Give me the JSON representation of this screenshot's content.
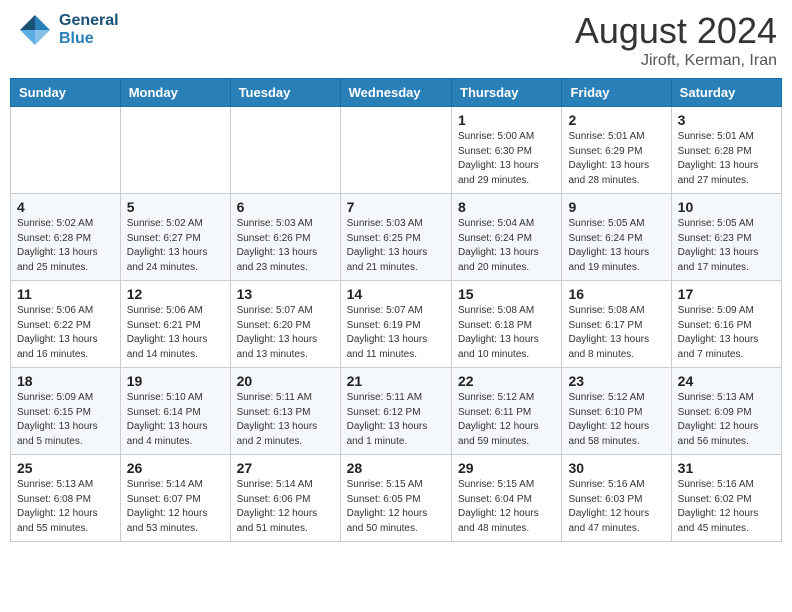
{
  "header": {
    "logo_general": "General",
    "logo_blue": "Blue",
    "title": "August 2024",
    "location": "Jiroft, Kerman, Iran"
  },
  "weekdays": [
    "Sunday",
    "Monday",
    "Tuesday",
    "Wednesday",
    "Thursday",
    "Friday",
    "Saturday"
  ],
  "weeks": [
    [
      {
        "date": "",
        "info": ""
      },
      {
        "date": "",
        "info": ""
      },
      {
        "date": "",
        "info": ""
      },
      {
        "date": "",
        "info": ""
      },
      {
        "date": "1",
        "info": "Sunrise: 5:00 AM\nSunset: 6:30 PM\nDaylight: 13 hours\nand 29 minutes."
      },
      {
        "date": "2",
        "info": "Sunrise: 5:01 AM\nSunset: 6:29 PM\nDaylight: 13 hours\nand 28 minutes."
      },
      {
        "date": "3",
        "info": "Sunrise: 5:01 AM\nSunset: 6:28 PM\nDaylight: 13 hours\nand 27 minutes."
      }
    ],
    [
      {
        "date": "4",
        "info": "Sunrise: 5:02 AM\nSunset: 6:28 PM\nDaylight: 13 hours\nand 25 minutes."
      },
      {
        "date": "5",
        "info": "Sunrise: 5:02 AM\nSunset: 6:27 PM\nDaylight: 13 hours\nand 24 minutes."
      },
      {
        "date": "6",
        "info": "Sunrise: 5:03 AM\nSunset: 6:26 PM\nDaylight: 13 hours\nand 23 minutes."
      },
      {
        "date": "7",
        "info": "Sunrise: 5:03 AM\nSunset: 6:25 PM\nDaylight: 13 hours\nand 21 minutes."
      },
      {
        "date": "8",
        "info": "Sunrise: 5:04 AM\nSunset: 6:24 PM\nDaylight: 13 hours\nand 20 minutes."
      },
      {
        "date": "9",
        "info": "Sunrise: 5:05 AM\nSunset: 6:24 PM\nDaylight: 13 hours\nand 19 minutes."
      },
      {
        "date": "10",
        "info": "Sunrise: 5:05 AM\nSunset: 6:23 PM\nDaylight: 13 hours\nand 17 minutes."
      }
    ],
    [
      {
        "date": "11",
        "info": "Sunrise: 5:06 AM\nSunset: 6:22 PM\nDaylight: 13 hours\nand 16 minutes."
      },
      {
        "date": "12",
        "info": "Sunrise: 5:06 AM\nSunset: 6:21 PM\nDaylight: 13 hours\nand 14 minutes."
      },
      {
        "date": "13",
        "info": "Sunrise: 5:07 AM\nSunset: 6:20 PM\nDaylight: 13 hours\nand 13 minutes."
      },
      {
        "date": "14",
        "info": "Sunrise: 5:07 AM\nSunset: 6:19 PM\nDaylight: 13 hours\nand 11 minutes."
      },
      {
        "date": "15",
        "info": "Sunrise: 5:08 AM\nSunset: 6:18 PM\nDaylight: 13 hours\nand 10 minutes."
      },
      {
        "date": "16",
        "info": "Sunrise: 5:08 AM\nSunset: 6:17 PM\nDaylight: 13 hours\nand 8 minutes."
      },
      {
        "date": "17",
        "info": "Sunrise: 5:09 AM\nSunset: 6:16 PM\nDaylight: 13 hours\nand 7 minutes."
      }
    ],
    [
      {
        "date": "18",
        "info": "Sunrise: 5:09 AM\nSunset: 6:15 PM\nDaylight: 13 hours\nand 5 minutes."
      },
      {
        "date": "19",
        "info": "Sunrise: 5:10 AM\nSunset: 6:14 PM\nDaylight: 13 hours\nand 4 minutes."
      },
      {
        "date": "20",
        "info": "Sunrise: 5:11 AM\nSunset: 6:13 PM\nDaylight: 13 hours\nand 2 minutes."
      },
      {
        "date": "21",
        "info": "Sunrise: 5:11 AM\nSunset: 6:12 PM\nDaylight: 13 hours\nand 1 minute."
      },
      {
        "date": "22",
        "info": "Sunrise: 5:12 AM\nSunset: 6:11 PM\nDaylight: 12 hours\nand 59 minutes."
      },
      {
        "date": "23",
        "info": "Sunrise: 5:12 AM\nSunset: 6:10 PM\nDaylight: 12 hours\nand 58 minutes."
      },
      {
        "date": "24",
        "info": "Sunrise: 5:13 AM\nSunset: 6:09 PM\nDaylight: 12 hours\nand 56 minutes."
      }
    ],
    [
      {
        "date": "25",
        "info": "Sunrise: 5:13 AM\nSunset: 6:08 PM\nDaylight: 12 hours\nand 55 minutes."
      },
      {
        "date": "26",
        "info": "Sunrise: 5:14 AM\nSunset: 6:07 PM\nDaylight: 12 hours\nand 53 minutes."
      },
      {
        "date": "27",
        "info": "Sunrise: 5:14 AM\nSunset: 6:06 PM\nDaylight: 12 hours\nand 51 minutes."
      },
      {
        "date": "28",
        "info": "Sunrise: 5:15 AM\nSunset: 6:05 PM\nDaylight: 12 hours\nand 50 minutes."
      },
      {
        "date": "29",
        "info": "Sunrise: 5:15 AM\nSunset: 6:04 PM\nDaylight: 12 hours\nand 48 minutes."
      },
      {
        "date": "30",
        "info": "Sunrise: 5:16 AM\nSunset: 6:03 PM\nDaylight: 12 hours\nand 47 minutes."
      },
      {
        "date": "31",
        "info": "Sunrise: 5:16 AM\nSunset: 6:02 PM\nDaylight: 12 hours\nand 45 minutes."
      }
    ]
  ]
}
